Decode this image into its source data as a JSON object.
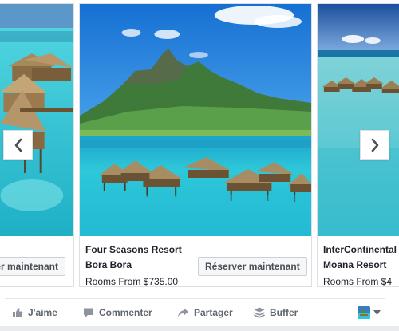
{
  "carousel": {
    "cards": [
      {
        "id": "left",
        "title_line1": "",
        "title_line2": "",
        "subtitle": "",
        "cta": "Réserver maintenant"
      },
      {
        "id": "center",
        "title_line1": "Four Seasons Resort",
        "title_line2": "Bora Bora",
        "subtitle": "Rooms From $735.00",
        "cta": "Réserver maintenant"
      },
      {
        "id": "right",
        "title_line1": "InterContinental",
        "title_line2": "Moana Resort",
        "subtitle": "Rooms From $4",
        "cta": ""
      }
    ],
    "prev_icon": "chevron-left-icon",
    "next_icon": "chevron-right-icon"
  },
  "actions": {
    "like": "J'aime",
    "comment": "Commenter",
    "share": "Partager",
    "buffer": "Buffer"
  },
  "colors": {
    "action_text": "#606770",
    "border": "#dddfe2",
    "lagoon": "#2fc6d6",
    "sky": "#1e7fd6"
  }
}
